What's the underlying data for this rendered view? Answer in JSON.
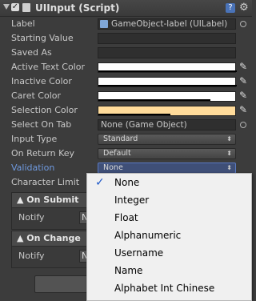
{
  "component": {
    "title": "UIInput (Script)"
  },
  "rows": [
    {
      "label": "Label",
      "value": "GameObject-label (UILabel)"
    },
    {
      "label": "Starting Value",
      "value": ""
    },
    {
      "label": "Saved As",
      "value": ""
    },
    {
      "label": "Active Text Color"
    },
    {
      "label": "Inactive Color"
    },
    {
      "label": "Caret Color"
    },
    {
      "label": "Selection Color"
    },
    {
      "label": "Select On Tab",
      "value": "None (Game Object)"
    },
    {
      "label": "Input Type",
      "value": "Standard"
    },
    {
      "label": "On Return Key",
      "value": "Default"
    },
    {
      "label": "Validation",
      "value": "None"
    },
    {
      "label": "Character Limit"
    }
  ],
  "colors": {
    "active_text": "#ffffff",
    "inactive": "#ffffff",
    "caret": "#ffffff",
    "selection": "#ffdb9a"
  },
  "events": [
    {
      "title": "On Submit",
      "notify_label": "Notify",
      "notify_value": "N"
    },
    {
      "title": "On Change",
      "notify_label": "Notify",
      "notify_value": "N"
    }
  ],
  "validation_menu": {
    "selected": "None",
    "options": [
      "None",
      "Integer",
      "Float",
      "Alphanumeric",
      "Username",
      "Name",
      "Alphabet Int Chinese"
    ]
  }
}
